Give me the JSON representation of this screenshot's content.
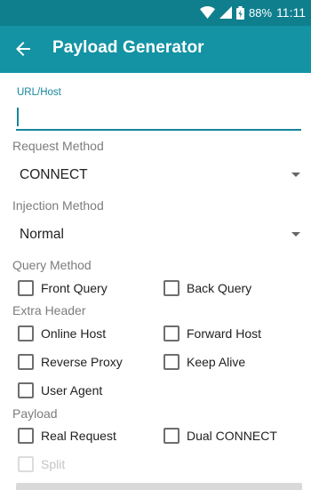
{
  "status_bar": {
    "battery": "88%",
    "time": "11:11",
    "icons": [
      "wifi-icon",
      "signal-icon",
      "battery-icon"
    ]
  },
  "app_bar": {
    "title": "Payload Generator",
    "back_icon": "arrow-left-icon"
  },
  "url_host": {
    "label": "URL/Host",
    "value": ""
  },
  "request_method": {
    "label": "Request Method",
    "selected": "CONNECT"
  },
  "injection_method": {
    "label": "Injection Method",
    "selected": "Normal"
  },
  "query_method": {
    "label": "Query Method",
    "options": [
      {
        "label": "Front Query",
        "checked": false
      },
      {
        "label": "Back Query",
        "checked": false
      }
    ]
  },
  "extra_header": {
    "label": "Extra Header",
    "options": [
      {
        "label": "Online Host",
        "checked": false
      },
      {
        "label": "Forward Host",
        "checked": false
      },
      {
        "label": "Reverse Proxy",
        "checked": false
      },
      {
        "label": "Keep Alive",
        "checked": false
      },
      {
        "label": "User Agent",
        "checked": false
      }
    ]
  },
  "payload": {
    "label": "Payload",
    "options": [
      {
        "label": "Real Request",
        "checked": false
      },
      {
        "label": "Dual CONNECT",
        "checked": false
      },
      {
        "label": "Split",
        "checked": false,
        "enabled": false
      }
    ]
  },
  "colors": {
    "accent": "#15869a",
    "app_bar": "#1393a4",
    "status_bar": "#0f7f8e"
  }
}
